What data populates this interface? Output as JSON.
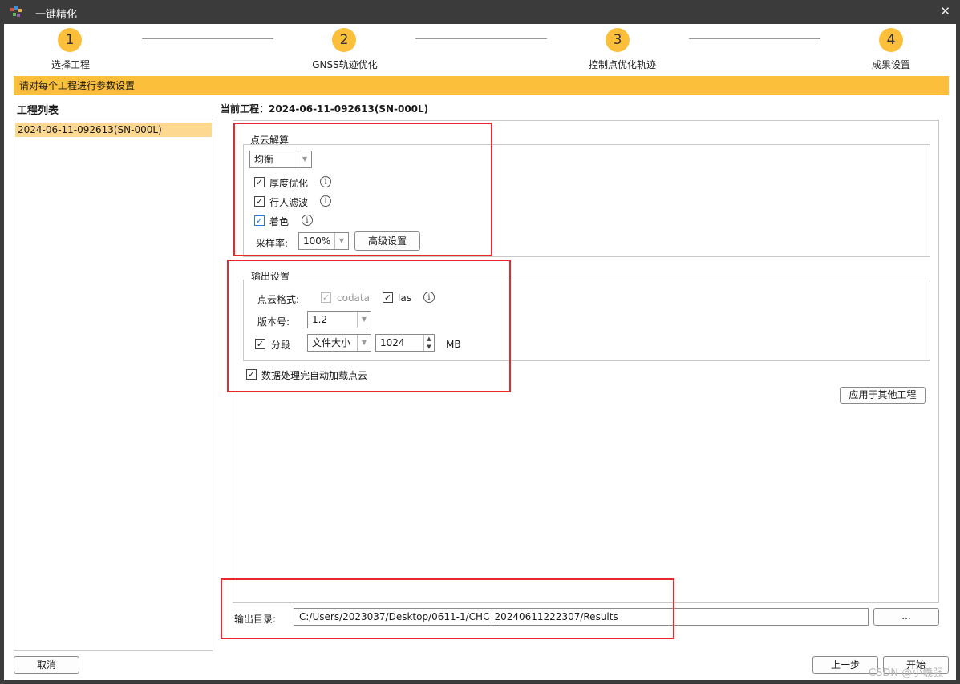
{
  "window": {
    "title": "一键精化",
    "close_glyph": "✕"
  },
  "steps": [
    {
      "num": "1",
      "label": "选择工程"
    },
    {
      "num": "2",
      "label": "GNSS轨迹优化"
    },
    {
      "num": "3",
      "label": "控制点优化轨迹"
    },
    {
      "num": "4",
      "label": "成果设置"
    }
  ],
  "banner": "请对每个工程进行参数设置",
  "project_list": {
    "title": "工程列表",
    "items": [
      "2024-06-11-092613(SN-000L)"
    ]
  },
  "current_project": "当前工程：2024-06-11-092613(SN-000L)",
  "pointcloud": {
    "group_label": "点云解算",
    "mode": "均衡",
    "thickness_opt": {
      "label": "厚度优化",
      "checked": true
    },
    "pedestrian_filter": {
      "label": "行人滤波",
      "checked": true
    },
    "coloring": {
      "label": "着色",
      "checked": true
    },
    "sample_rate_label": "采样率:",
    "sample_rate": "100%",
    "advanced_button": "高级设置"
  },
  "output": {
    "group_label": "输出设置",
    "format_label": "点云格式:",
    "codata": {
      "label": "codata",
      "checked": true,
      "disabled": true
    },
    "las": {
      "label": "las",
      "checked": true
    },
    "version_label": "版本号:",
    "version": "1.2",
    "segment": {
      "label": "分段",
      "checked": true
    },
    "segment_mode": "文件大小",
    "segment_size": "1024",
    "segment_unit": "MB",
    "autoload": {
      "label": "数据处理完自动加载点云",
      "checked": true
    }
  },
  "apply_button": "应用于其他工程",
  "output_dir": {
    "label": "输出目录:",
    "value": "C:/Users/2023037/Desktop/0611-1/CHC_20240611222307/Results",
    "browse_button": "..."
  },
  "footer": {
    "cancel": "取消",
    "prev": "上一步",
    "start": "开始",
    "watermark": "CSDN @小羲强"
  },
  "colors": {
    "accent": "#fbbf3c",
    "highlight": "#e8282e",
    "titlebar": "#3b3b3b"
  }
}
